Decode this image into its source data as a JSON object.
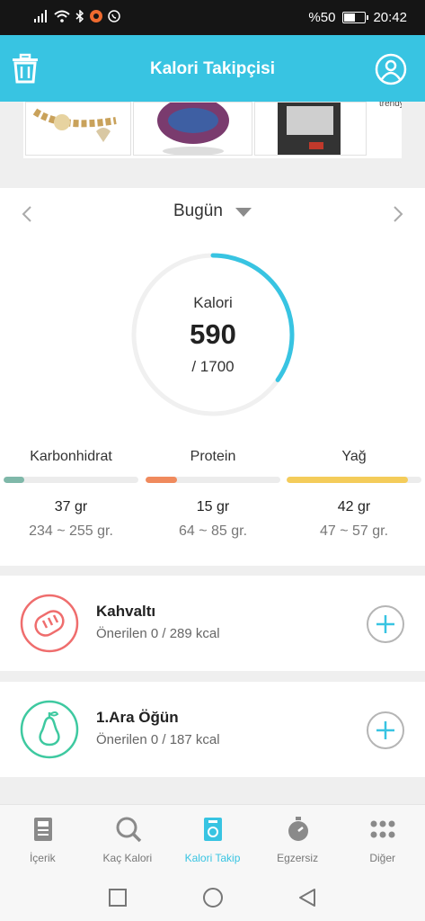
{
  "status_bar": {
    "battery_text": "%50",
    "time": "20:42"
  },
  "app_bar": {
    "title": "Kalori Takipçisi"
  },
  "ad": {
    "brand_text": "trendyol"
  },
  "date_nav": {
    "label": "Bugün"
  },
  "calories": {
    "label": "Kalori",
    "value": "590",
    "goal": "/ 1700",
    "progress": 0.347,
    "ring_color": "#38c4e2"
  },
  "macros": [
    {
      "name": "Karbonhidrat",
      "value": "37 gr",
      "range": "234 ~ 255 gr.",
      "progress": 0.15,
      "color": "#7fb8a9"
    },
    {
      "name": "Protein",
      "value": "15 gr",
      "range": "64 ~ 85 gr.",
      "progress": 0.23,
      "color": "#f08a5d"
    },
    {
      "name": "Yağ",
      "value": "42 gr",
      "range": "47 ~ 57 gr.",
      "progress": 0.9,
      "color": "#f4cc5a"
    }
  ],
  "meals": [
    {
      "title": "Kahvaltı",
      "subtitle": "Önerilen 0 / 289 kcal",
      "icon": "bread-icon",
      "color": "#ef6d6d"
    },
    {
      "title": "1.Ara Öğün",
      "subtitle": "Önerilen 0 / 187 kcal",
      "icon": "pear-icon",
      "color": "#3ec9a0"
    }
  ],
  "bottom_nav": [
    {
      "label": "İçerik",
      "icon": "article-icon",
      "active": false
    },
    {
      "label": "Kaç Kalori",
      "icon": "search-icon",
      "active": false
    },
    {
      "label": "Kalori Takip",
      "icon": "scale-icon",
      "active": true
    },
    {
      "label": "Egzersiz",
      "icon": "stopwatch-icon",
      "active": false
    },
    {
      "label": "Diğer",
      "icon": "grid-dots-icon",
      "active": false
    }
  ],
  "colors": {
    "accent": "#38c4e2",
    "inactive": "#777777"
  }
}
